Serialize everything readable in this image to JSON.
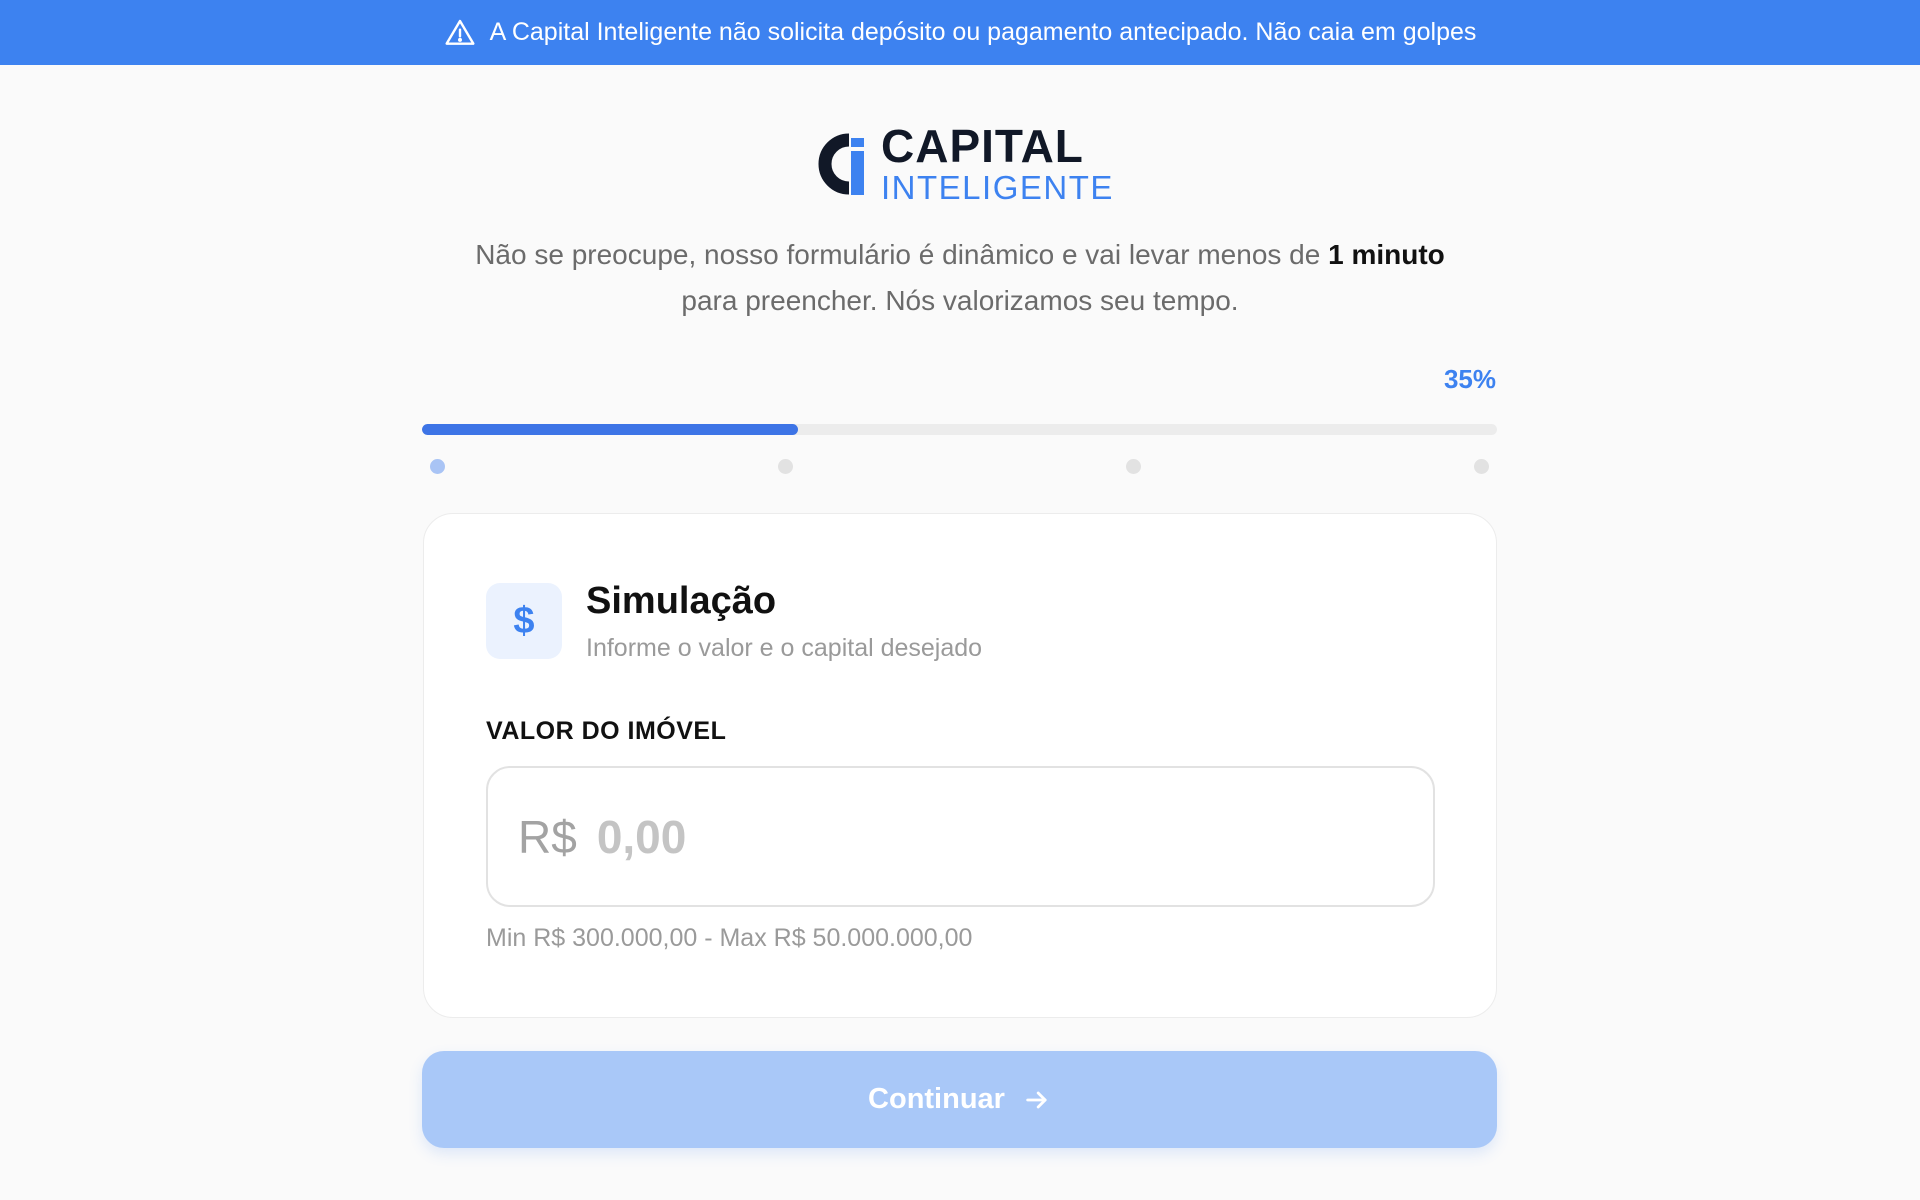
{
  "banner": {
    "icon": "warning-triangle-icon",
    "text": "A Capital Inteligente não solicita depósito ou pagamento antecipado. Não caia em golpes",
    "background": "#3d82f0"
  },
  "logo": {
    "line1": "CAPITAL",
    "line2": "INTELIGENTE"
  },
  "intro": {
    "text_before": "Não se preocupe, nosso formulário é dinâmico e vai levar menos de ",
    "bold": "1 minuto",
    "text_after": "para preencher. Nós valorizamos seu tempo."
  },
  "progress": {
    "percent_label": "35%",
    "value": 0.35,
    "steps": 4,
    "current_step": 1
  },
  "section": {
    "icon": "dollar-icon",
    "icon_glyph": "$",
    "title": "Simulação",
    "subtitle": "Informe o valor e o capital desejado"
  },
  "field": {
    "label": "VALOR DO IMÓVEL",
    "currency": "R$",
    "value": "",
    "placeholder": "0,00",
    "hint": "Min R$ 300.000,00 - Max R$ 50.000.000,00"
  },
  "actions": {
    "continue_label": "Continuar",
    "continue_icon": "arrow-right-icon"
  },
  "colors": {
    "accent": "#3d82f0",
    "button_disabled": "#a9c8f8",
    "background": "#fafafa"
  }
}
